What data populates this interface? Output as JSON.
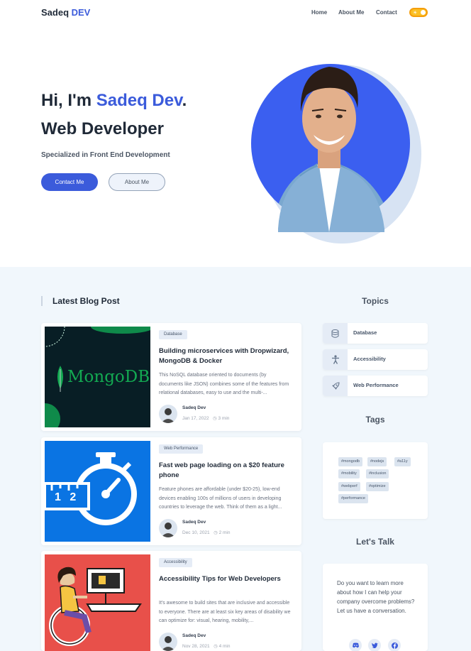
{
  "header": {
    "logo_main": "Sadeq ",
    "logo_accent": "DEV",
    "nav": [
      "Home",
      "About Me",
      "Contact"
    ],
    "theme_toggle": "on"
  },
  "hero": {
    "greeting": "Hi, I'm ",
    "name": "Sadeq Dev",
    "period": ".",
    "role": "Web Developer",
    "subtitle": "Specialized in Front End Development",
    "contact_button": "Contact Me",
    "about_button": "About Me"
  },
  "blog": {
    "heading": "Latest Blog Post",
    "posts": [
      {
        "tag": "Database",
        "title": "Building microservices with Dropwizard, MongoDB & Docker",
        "excerpt": "This NoSQL database oriented to documents (by documents like JSON) combines some of the features from relational databases, easy to use and the multi-...",
        "thumb_text": "MongoDB.",
        "author": "Sadeq Dev",
        "date": "Jan 17, 2022",
        "read_time": "3 min"
      },
      {
        "tag": "Web Performance",
        "title": "Fast web page loading on a $20 feature phone",
        "excerpt": "Feature phones are affordable (under $20-25), low-end devices enabling 100s of millions of users in developing countries to leverage the web. Think of them as a light...",
        "thumb_text": "1 2",
        "author": "Sadeq Dev",
        "date": "Dec 10, 2021",
        "read_time": "2 min"
      },
      {
        "tag": "Accessibility",
        "title": "Accessibility Tips for Web Developers",
        "excerpt": "It's awesome to build sites that are inclusive and accessible to everyone. There are at least six key areas of disability we can optimize for: visual, hearing, mobility,...",
        "thumb_text": "",
        "author": "Sadeq Dev",
        "date": "Nov 28, 2021",
        "read_time": "4 min"
      }
    ]
  },
  "sidebar": {
    "topics_heading": "Topics",
    "topics": [
      {
        "label": "Database",
        "icon": "database-icon"
      },
      {
        "label": "Accessibility",
        "icon": "accessibility-icon"
      },
      {
        "label": "Web Performance",
        "icon": "rocket-icon"
      }
    ],
    "tags_heading": "Tags",
    "tags": [
      "#mongodb",
      "#nodejs",
      "#a11y",
      "#mobility",
      "#inclusion",
      "#webperf",
      "#optimize",
      "#performance"
    ],
    "talk_heading": "Let's Talk",
    "talk_text": "Do you want to learn more about how I can help your company overcome problems? Let us have a conversation.",
    "social": [
      "discord-icon",
      "twitter-icon",
      "facebook-icon"
    ]
  },
  "colors": {
    "accent": "#3b5bdb",
    "section_bg": "#f1f7fc",
    "toggle": "#fbbf24"
  }
}
